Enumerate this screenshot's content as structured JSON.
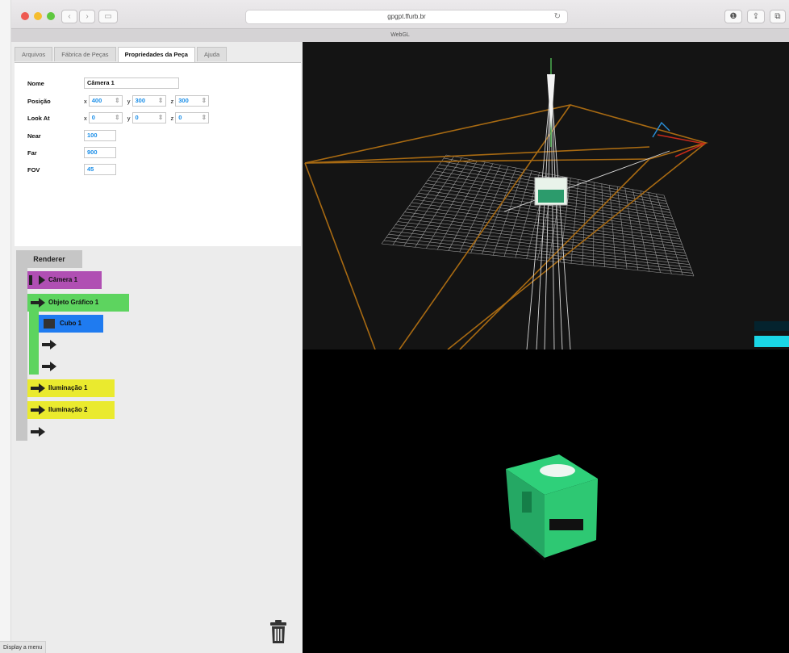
{
  "browser": {
    "url": "gpgpt.ffurb.br",
    "tab_title": "WebGL",
    "nav_back": "‹",
    "nav_forward": "›",
    "sidebar_glyph": "▭",
    "reload_glyph": "↻",
    "right_buttons": [
      "❶",
      "⇪",
      "⧉"
    ]
  },
  "tabs": [
    {
      "label": "Arquivos",
      "active": false
    },
    {
      "label": "Fábrica de Peças",
      "active": false
    },
    {
      "label": "Propriedades da Peça",
      "active": true
    },
    {
      "label": "Ajuda",
      "active": false
    }
  ],
  "properties": {
    "name_label": "Nome",
    "name_value": "Câmera 1",
    "position_label": "Posição",
    "position": {
      "x": "400",
      "y": "300",
      "z": "300"
    },
    "lookat_label": "Look At",
    "lookat": {
      "x": "0",
      "y": "0",
      "z": "0"
    },
    "near_label": "Near",
    "near_value": "100",
    "far_label": "Far",
    "far_value": "900",
    "fov_label": "FOV",
    "fov_value": "45",
    "axis_x": "x",
    "axis_y": "y",
    "axis_z": "z"
  },
  "tree": {
    "root": "Renderer",
    "nodes": [
      {
        "label": "Câmera 1",
        "color": "#b04fb3"
      },
      {
        "label": "Objeto Gráfico 1",
        "color": "#5dd45f"
      },
      {
        "label": "Cubo 1",
        "color": "#1f7bf0"
      },
      {
        "label": "Iluminação 1",
        "color": "#eaea2e"
      },
      {
        "label": "Iluminação 2",
        "color": "#eaea2e"
      }
    ]
  },
  "status_text": "Display a menu",
  "icons": [
    "trash-icon",
    "arrow-right-icon",
    "cube-icon",
    "back-icon",
    "forward-icon",
    "reload-icon"
  ],
  "colors": {
    "camera": "#b04fb3",
    "object": "#5dd45f",
    "cube": "#1f7bf0",
    "light": "#eaea2e",
    "frustum": "#a86a12",
    "value_text": "#1a8ee8"
  }
}
